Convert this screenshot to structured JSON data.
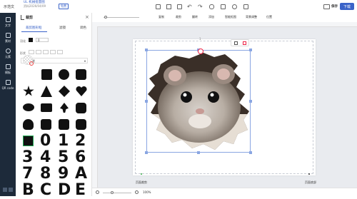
{
  "topbar": {
    "doc_label": "示范文",
    "subtitle": "UL 机械批量图",
    "subtitle2": "资料2026/04/09",
    "badge": "免费",
    "zoom_label": "100",
    "save_label": "保存",
    "download_label": "下载"
  },
  "nav": {
    "items": [
      {
        "label": "文字"
      },
      {
        "label": "素材"
      },
      {
        "label": "元素"
      },
      {
        "label": "模板"
      },
      {
        "label": "QR code"
      }
    ]
  },
  "panel": {
    "title": "裁剪",
    "tabs": [
      "裁剪图形框",
      "滤镜",
      "调色"
    ],
    "feather_label": "羽化",
    "feather_value": "0",
    "shape_label": "形状",
    "dropdown_value": "所有形状",
    "numbers": [
      "0",
      "1",
      "2",
      "3",
      "4",
      "5",
      "6",
      "7",
      "8",
      "9",
      "A",
      "B",
      "C",
      "D",
      "E"
    ]
  },
  "toolbar": {
    "items": [
      {
        "label": "复制"
      },
      {
        "label": "裁剪"
      },
      {
        "label": "翻转"
      },
      {
        "label": "添加"
      },
      {
        "label": "智能抠图"
      },
      {
        "label": "背景调整"
      },
      {
        "label": "位置"
      }
    ]
  },
  "canvas": {
    "page_number": "1",
    "left_marker": "页面裁剪",
    "right_marker": "页面底部"
  },
  "bottom": {
    "zoom_value": "100%"
  },
  "colors": {
    "accent": "#3a63c8",
    "nav_bg": "#1d2a3a",
    "selection": "#8aa6e2"
  }
}
